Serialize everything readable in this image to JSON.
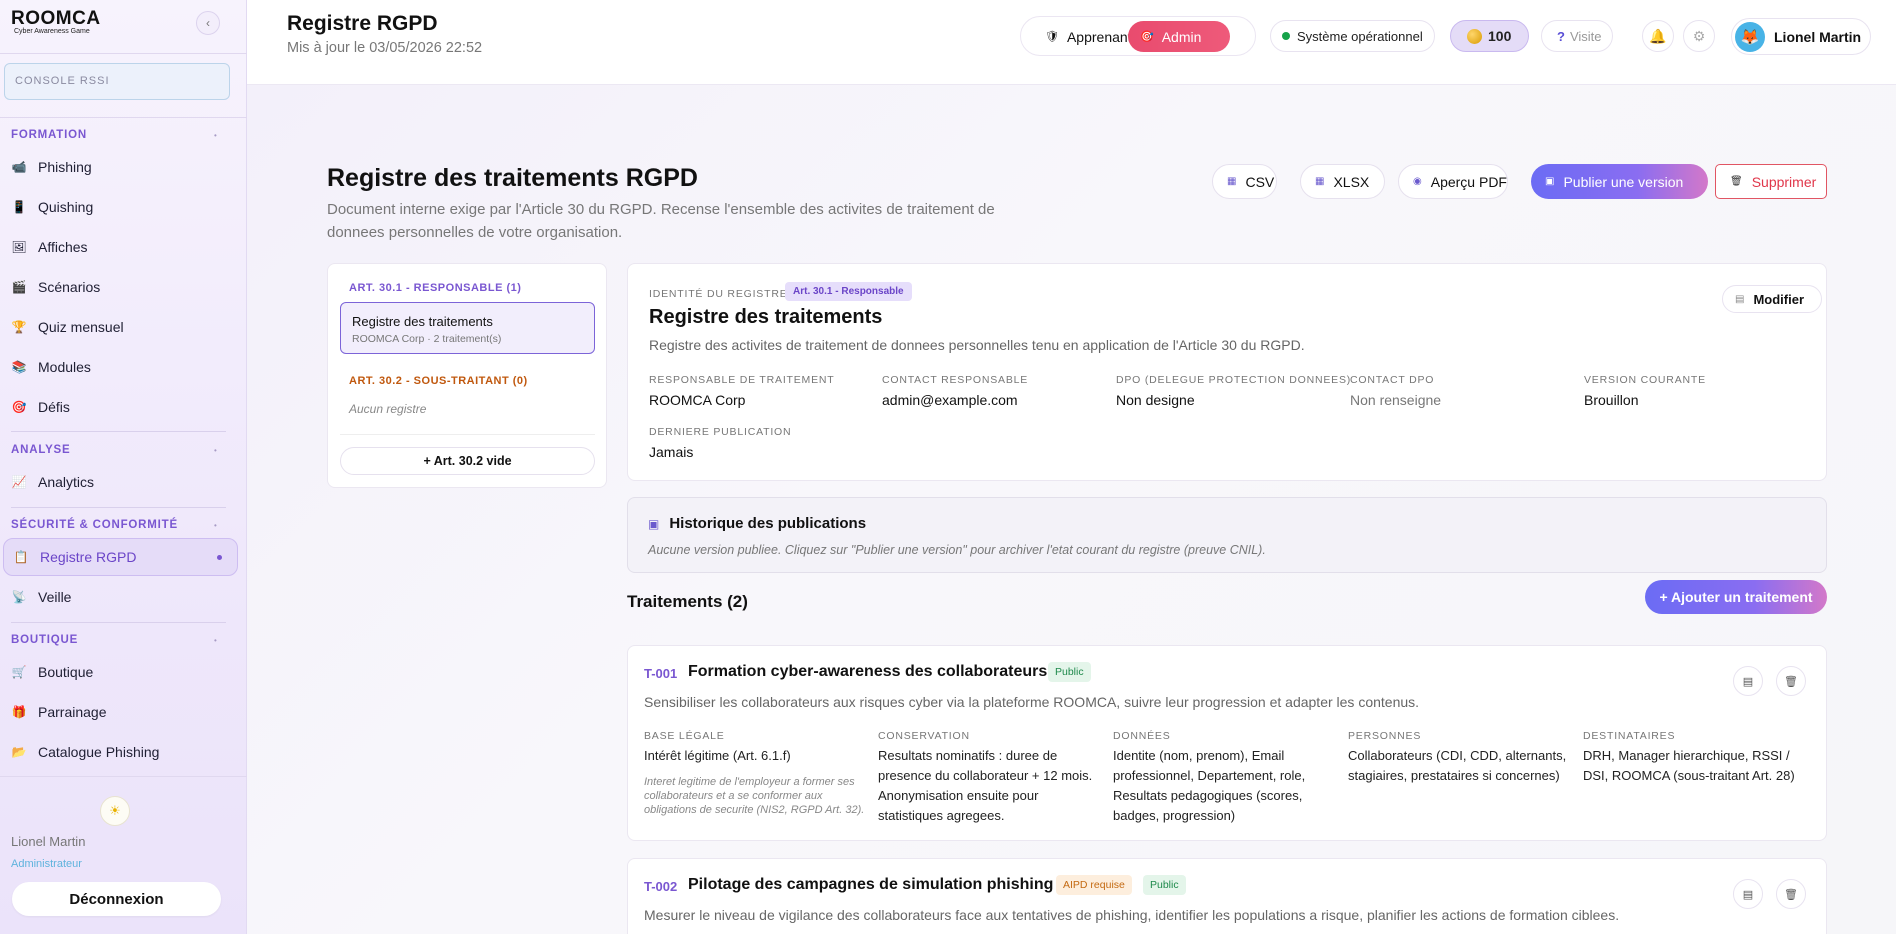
{
  "brand": {
    "logo": "ROOMCA",
    "tagline": "Cyber Awareness Game"
  },
  "sidebar": {
    "collapse_glyph": "‹",
    "console_label": "CONSOLE RSSI",
    "sections": [
      {
        "title": "FORMATION",
        "items": [
          {
            "label": "Phishing",
            "icon": "📹"
          },
          {
            "label": "Quishing",
            "icon": "📱"
          },
          {
            "label": "Affiches",
            "icon": "🖼"
          },
          {
            "label": "Scénarios",
            "icon": "🎬"
          },
          {
            "label": "Quiz mensuel",
            "icon": "🏆"
          },
          {
            "label": "Modules",
            "icon": "📚"
          },
          {
            "label": "Défis",
            "icon": "🎯"
          }
        ]
      },
      {
        "title": "ANALYSE",
        "items": [
          {
            "label": "Analytics",
            "icon": "📈"
          }
        ]
      },
      {
        "title": "SÉCURITÉ & CONFORMITÉ",
        "items": [
          {
            "label": "Registre RGPD",
            "icon": "📋"
          },
          {
            "label": "Veille",
            "icon": "📡"
          }
        ]
      },
      {
        "title": "BOUTIQUE",
        "items": [
          {
            "label": "Boutique",
            "icon": "🛒"
          },
          {
            "label": "Parrainage",
            "icon": "🎁"
          },
          {
            "label": "Catalogue Phishing",
            "icon": "📂"
          }
        ]
      }
    ],
    "theme_icon": "☀",
    "user_name": "Lionel Martin",
    "user_role": "Administrateur",
    "logout_label": "Déconnexion"
  },
  "header": {
    "title": "Registre RGPD",
    "updated": "Mis à jour le 03/05/2026 22:52",
    "role_apprenant": "Apprenant",
    "role_admin": "Admin",
    "system_status": "Système opérationnel",
    "coins": "100",
    "visit_label": "Visite",
    "user_name": "Lionel Martin",
    "status_color": "#16a34a",
    "admin_color": "#e94b6e"
  },
  "page": {
    "title": "Registre des traitements RGPD",
    "description": "Document interne exige par l'Article 30 du RGPD. Recense l'ensemble des activites de traitement de donnees personnelles de votre organisation.",
    "actions": {
      "csv": "CSV",
      "xlsx": "XLSX",
      "pdf": "Aperçu PDF",
      "publish": "Publier une version",
      "delete": "Supprimer"
    }
  },
  "registry_nav": {
    "resp_label": "ART. 30.1 - RESPONSABLE (1)",
    "resp_item_title": "Registre des traitements",
    "resp_item_sub": "ROOMCA Corp · 2 traitement(s)",
    "sub_label": "ART. 30.2 - SOUS-TRAITANT (0)",
    "sub_empty": "Aucun registre",
    "add_button": "+ Art. 30.2 vide"
  },
  "identity": {
    "caption": "IDENTITÉ DU REGISTRE",
    "badge": "Art. 30.1 - Responsable",
    "title": "Registre des traitements",
    "description": "Registre des activites de traitement de donnees personnelles tenu en application de l'Article 30 du RGPD.",
    "modify_label": "Modifier",
    "fields": [
      {
        "label": "RESPONSABLE DE TRAITEMENT",
        "value": "ROOMCA Corp"
      },
      {
        "label": "CONTACT RESPONSABLE",
        "value": "admin@example.com"
      },
      {
        "label": "DPO (DELEGUE PROTECTION DONNEES)",
        "value": "Non designe"
      },
      {
        "label": "CONTACT DPO",
        "value": "Non renseigne"
      },
      {
        "label": "VERSION COURANTE",
        "value": "Brouillon"
      },
      {
        "label": "DERNIERE PUBLICATION",
        "value": "Jamais"
      }
    ]
  },
  "history": {
    "title": "Historique des publications",
    "empty": "Aucune version publiee. Cliquez sur \"Publier une version\" pour archiver l'etat courant du registre (preuve CNIL)."
  },
  "treatments": {
    "heading": "Traitements (2)",
    "add_label": "+ Ajouter un traitement",
    "items": [
      {
        "code": "T-001",
        "title": "Formation cyber-awareness des collaborateurs",
        "tags": [
          "Public"
        ],
        "description": "Sensibiliser les collaborateurs aux risques cyber via la plateforme ROOMCA, suivre leur progression et adapter les contenus.",
        "columns": [
          {
            "label": "BASE LÉGALE",
            "value": "Intérêt légitime (Art. 6.1.f)",
            "note": "Interet legitime de l'employeur a former ses collaborateurs et a se conformer aux obligations de securite (NIS2, RGPD Art. 32)."
          },
          {
            "label": "CONSERVATION",
            "value": "Resultats nominatifs : duree de presence du collaborateur + 12 mois. Anonymisation ensuite pour statistiques agregees."
          },
          {
            "label": "DONNÉES",
            "value": "Identite (nom, prenom), Email professionnel, Departement, role, Resultats pedagogiques (scores, badges, progression)"
          },
          {
            "label": "PERSONNES",
            "value": "Collaborateurs (CDI, CDD, alternants, stagiaires, prestataires si concernes)"
          },
          {
            "label": "DESTINATAIRES",
            "value": "DRH, Manager hierarchique, RSSI / DSI, ROOMCA (sous-traitant Art. 28)"
          }
        ]
      },
      {
        "code": "T-002",
        "title": "Pilotage des campagnes de simulation phishing",
        "tags": [
          "AIPD requise",
          "Public"
        ],
        "description": "Mesurer le niveau de vigilance des collaborateurs face aux tentatives de phishing, identifier les populations a risque, planifier les actions de formation ciblees."
      }
    ]
  }
}
